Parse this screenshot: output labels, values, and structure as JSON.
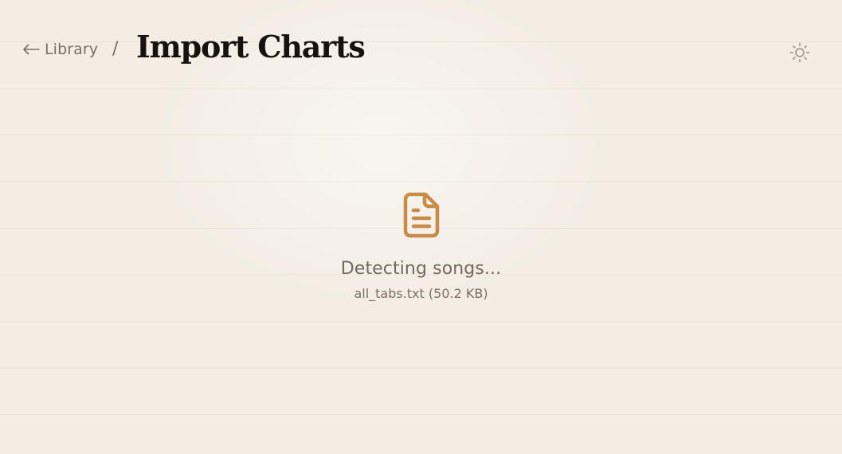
{
  "header": {
    "back_arrow_icon": "arrow-left-icon",
    "back_label": "Library",
    "separator": "/",
    "title": "Import Charts",
    "theme_toggle_icon": "sun-icon"
  },
  "status": {
    "icon": "file-text-icon",
    "message": "Detecting songs...",
    "file_name": "all_tabs.txt",
    "file_size": "50.2 KB",
    "file_info": "all_tabs.txt (50.2 KB)"
  },
  "colors": {
    "background": "#f3ede4",
    "rule_lines": "#e6dccd",
    "title_text": "#17120d",
    "muted_text": "#7a7064",
    "accent_icon": "#c98b48",
    "toggle_icon": "#a29a8f"
  }
}
